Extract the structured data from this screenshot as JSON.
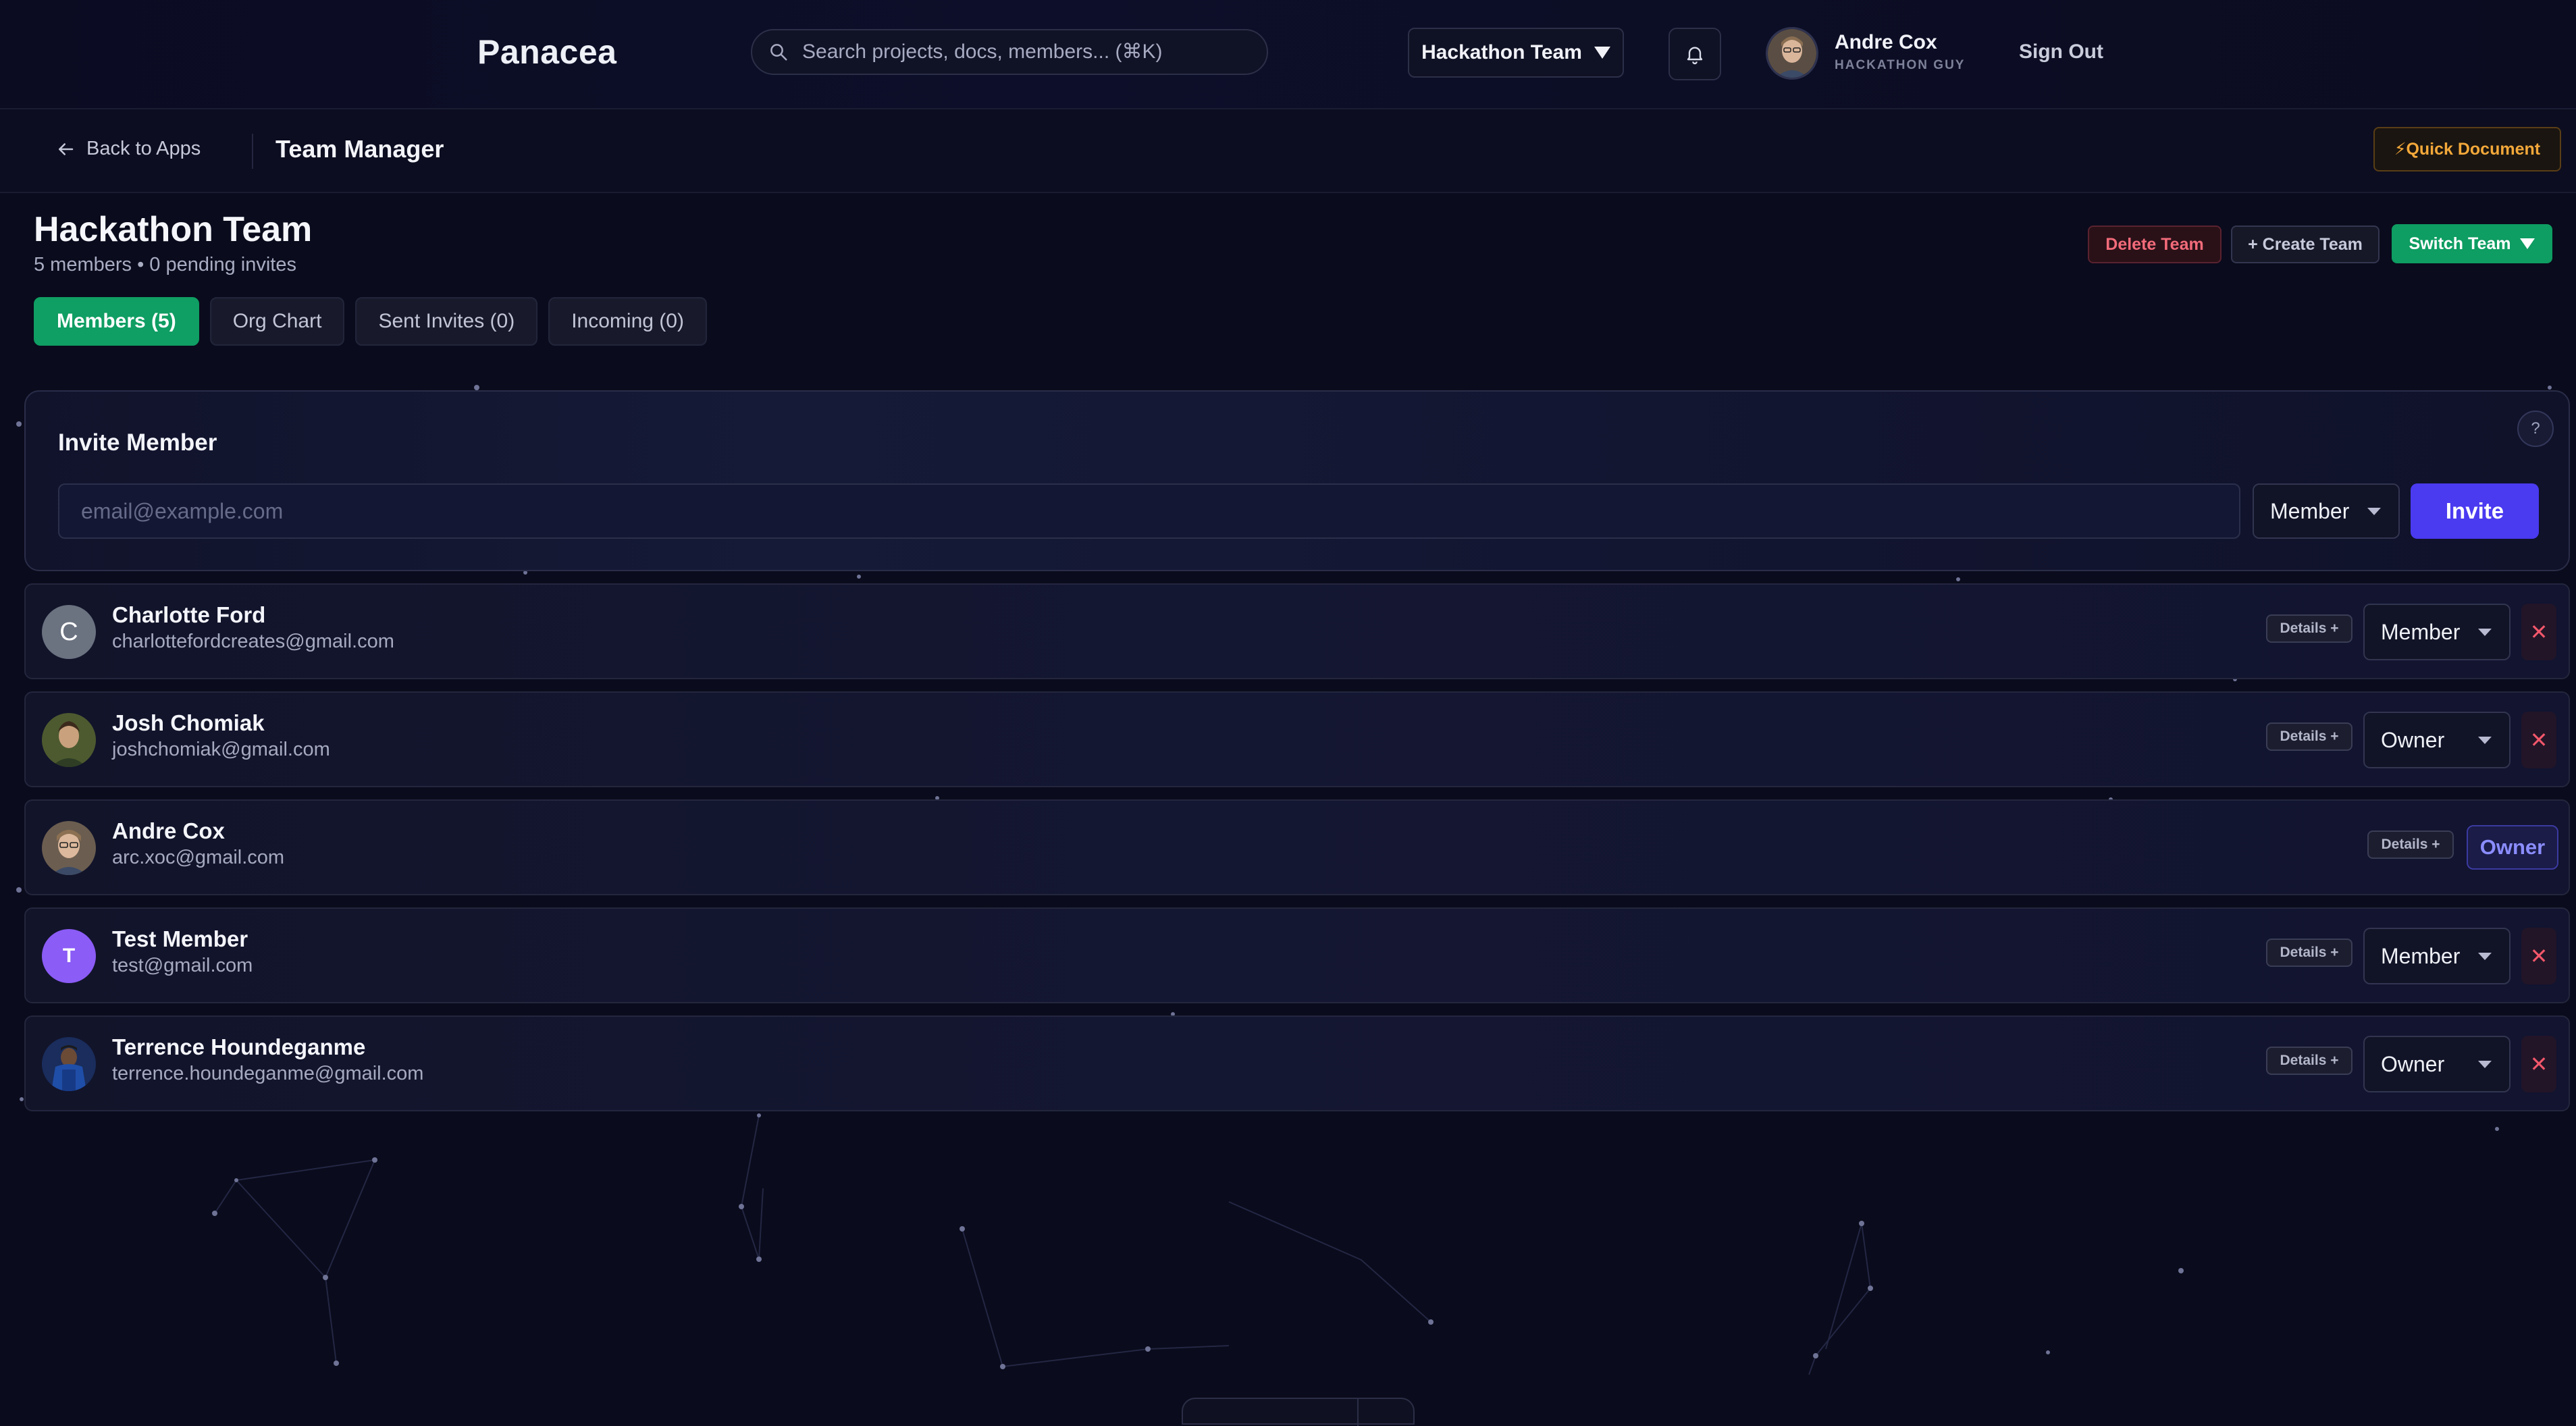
{
  "header": {
    "logo": "Panacea",
    "search_placeholder": "Search projects, docs, members... (⌘K)",
    "team_selector": "Hackathon Team",
    "user": {
      "name": "Andre Cox",
      "role": "HACKATHON GUY"
    },
    "sign_out": "Sign Out"
  },
  "subheader": {
    "back_label": "Back to Apps",
    "title": "Team Manager",
    "quick_document": "⚡Quick Document"
  },
  "team": {
    "name": "Hackathon Team",
    "meta": "5 members • 0 pending invites",
    "delete_label": "Delete Team",
    "create_label": "+ Create Team",
    "switch_label": "Switch Team"
  },
  "tabs": [
    {
      "label": "Members (5)",
      "active": true
    },
    {
      "label": "Org Chart",
      "active": false
    },
    {
      "label": "Sent Invites (0)",
      "active": false
    },
    {
      "label": "Incoming (0)",
      "active": false
    }
  ],
  "invite": {
    "title": "Invite Member",
    "help": "?",
    "email_placeholder": "email@example.com",
    "role": "Member",
    "button": "Invite"
  },
  "members": [
    {
      "name": "Charlotte Ford",
      "email": "charlottefordcreates@gmail.com",
      "initial": "C",
      "role": "Member",
      "details": "Details +",
      "remove": "✕",
      "avatar_color": "#6b7280"
    },
    {
      "name": "Josh Chomiak",
      "email": "joshchomiak@gmail.com",
      "initial": "",
      "role": "Owner",
      "details": "Details +",
      "remove": "✕",
      "avatar_color": "#5b6b3a"
    },
    {
      "name": "Andre Cox",
      "email": "arc.xoc@gmail.com",
      "initial": "",
      "role": "Owner",
      "details": "Details +",
      "remove": "",
      "avatar_color": "#8a7a66"
    },
    {
      "name": "Test Member",
      "email": "test@gmail.com",
      "initial": "T",
      "role": "Member",
      "details": "Details +",
      "remove": "✕",
      "avatar_color": "#8b5cf6"
    },
    {
      "name": "Terrence Houndeganme",
      "email": "terrence.houndeganme@gmail.com",
      "initial": "",
      "role": "Owner",
      "details": "Details +",
      "remove": "✕",
      "avatar_color": "#1f4ea8"
    }
  ],
  "colors": {
    "accent_green": "#0f9e63",
    "invite_purple": "#4a3af0",
    "danger_red": "#f2576b",
    "quickdoc_orange": "#f3a83a"
  }
}
